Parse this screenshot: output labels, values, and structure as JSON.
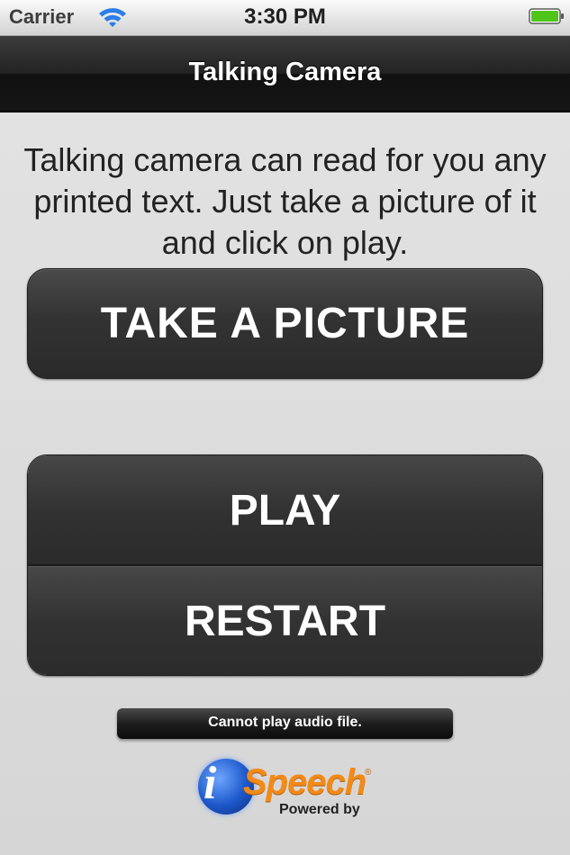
{
  "status_bar": {
    "carrier": "Carrier",
    "time": "3:30 PM",
    "wifi_icon": "wifi-icon",
    "battery_icon": "battery-full-icon",
    "battery_color": "#4fc51a"
  },
  "nav": {
    "title": "Talking Camera"
  },
  "content": {
    "description": "Talking camera can read for you any printed text. Just take a picture of it and click on play.",
    "take_picture_label": "TAKE A PICTURE",
    "play_label": "PLAY",
    "restart_label": "RESTART",
    "status_message": "Cannot play audio file."
  },
  "logo": {
    "i_letter": "i",
    "brand": "Speech",
    "registered": "®",
    "powered_by": "Powered by",
    "brand_color": "#f28a17",
    "circle_color": "#1c57c9"
  }
}
